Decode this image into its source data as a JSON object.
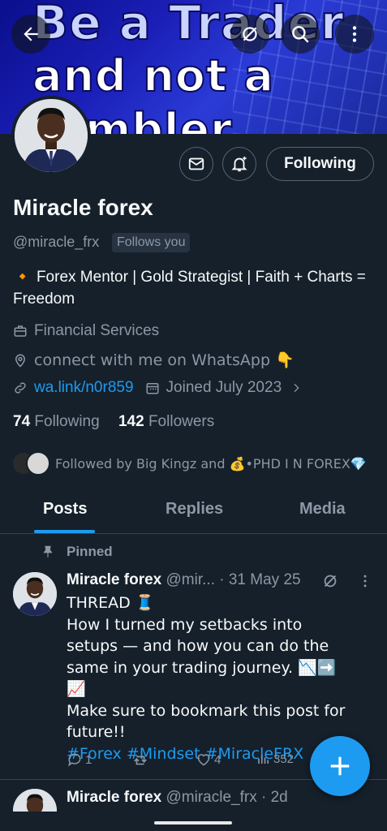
{
  "banner": {
    "line1": "Be a Trader",
    "line2": "and not a",
    "line3": "mbler"
  },
  "header": {
    "follow_button_label": "Following"
  },
  "profile": {
    "name": "Miracle forex",
    "handle": "@miracle_frx",
    "follows_you": "Follows you",
    "bio_bullet": "🔸",
    "bio": "Forex Mentor | Gold Strategist | Faith + Charts = Freedom",
    "category": "Financial Services",
    "location": "connect with me on WhatsApp 👇",
    "website": "wa.link/n0r859",
    "joined": "Joined July 2023",
    "following_count": "74",
    "following_label": "Following",
    "followers_count": "142",
    "followers_label": "Followers",
    "followed_by": "Followed by Big Kingz and 💰•PHD I N FOREX💎"
  },
  "tabs": [
    {
      "label": "Posts"
    },
    {
      "label": "Replies"
    },
    {
      "label": "Media"
    }
  ],
  "pinned_post": {
    "pinned_label": "Pinned",
    "author": "Miracle forex",
    "handle": "@mir...",
    "date": "· 31 May 25",
    "line1": "THREAD 🧵",
    "line2": "How I turned my setbacks into setups — and how you can do the same in your trading journey. 📉➡️📈",
    "line3": "Make sure to bookmark this post for future!!",
    "hashtags": "#Forex #Mindset #MiracleFRX",
    "replies": "1",
    "retweets": "",
    "likes": "4",
    "views": "352"
  },
  "next_post": {
    "author": "Miracle forex",
    "meta": "@miracle_frx · 2d"
  },
  "colors": {
    "background": "#15202b",
    "accent": "#1d9bf0",
    "muted": "#8b98a5"
  }
}
